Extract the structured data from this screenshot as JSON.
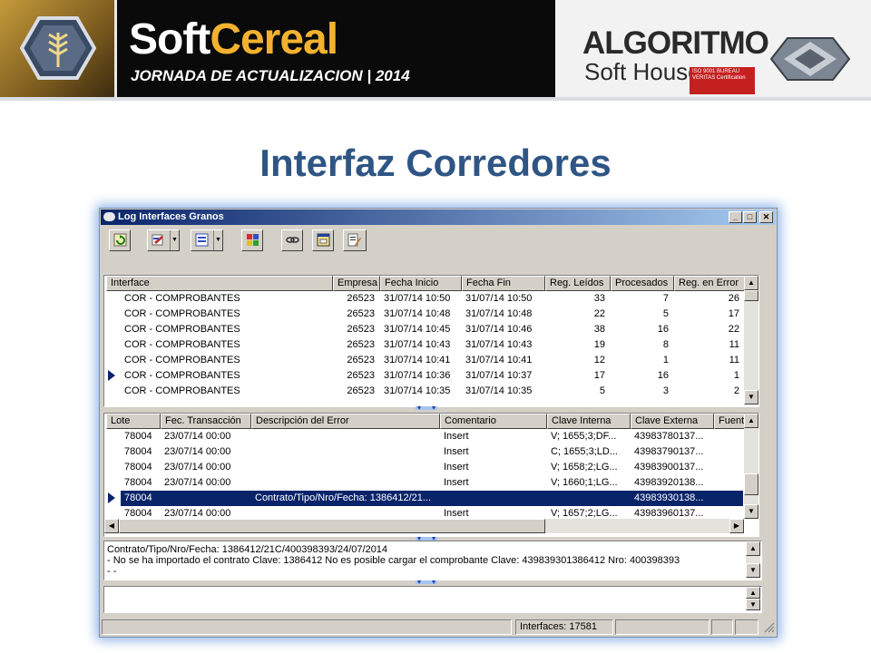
{
  "slide": {
    "banner": {
      "brand_part1": "Soft",
      "brand_part2": "Cereal",
      "brand_sub": "JORNADA DE ACTUALIZACION | 2014",
      "partner_title": "ALGORITMO",
      "partner_sub": "Soft House",
      "iso_text": "ISO 9001 BUREAU VERITAS Certification",
      "colors": {
        "brand_gold": "#f2b230",
        "banner_bg": "#0a0a0a",
        "iso_red": "#c42020"
      }
    },
    "title": "Interfaz Corredores",
    "title_color": "#2f5584"
  },
  "window": {
    "title": "Log Interfaces Granos",
    "controls": {
      "minimize": "_",
      "maximize": "□",
      "close": "✕"
    },
    "toolbar": [
      {
        "name": "refresh-icon",
        "dropdown": false
      },
      {
        "name": "edit-icon",
        "dropdown": true
      },
      {
        "name": "list-icon",
        "dropdown": true
      },
      {
        "name": "grid-color-icon",
        "dropdown": false
      },
      {
        "name": "link-icon",
        "dropdown": false
      },
      {
        "name": "window-icon",
        "dropdown": false
      },
      {
        "name": "report-edit-icon",
        "dropdown": false
      }
    ],
    "interfaces_grid": {
      "columns": [
        "Interface",
        "Empresa",
        "Fecha Inicio",
        "Fecha Fin",
        "Reg. Leídos",
        "Procesados",
        "Reg. en Error"
      ],
      "rows": [
        [
          "COR - COMPROBANTES",
          "26523",
          "31/07/14 10:50",
          "31/07/14 10:50",
          "33",
          "7",
          "26"
        ],
        [
          "COR - COMPROBANTES",
          "26523",
          "31/07/14 10:48",
          "31/07/14 10:48",
          "22",
          "5",
          "17"
        ],
        [
          "COR - COMPROBANTES",
          "26523",
          "31/07/14 10:45",
          "31/07/14 10:46",
          "38",
          "16",
          "22"
        ],
        [
          "COR - COMPROBANTES",
          "26523",
          "31/07/14 10:43",
          "31/07/14 10:43",
          "19",
          "8",
          "11"
        ],
        [
          "COR - COMPROBANTES",
          "26523",
          "31/07/14 10:41",
          "31/07/14 10:41",
          "12",
          "1",
          "11"
        ],
        [
          "COR - COMPROBANTES",
          "26523",
          "31/07/14 10:36",
          "31/07/14 10:37",
          "17",
          "16",
          "1"
        ],
        [
          "COR - COMPROBANTES",
          "26523",
          "31/07/14 10:35",
          "31/07/14 10:35",
          "5",
          "3",
          "2"
        ]
      ],
      "current_row": 5
    },
    "errors_grid": {
      "columns": [
        "Lote",
        "Fec. Transacción",
        "Descripción del Error",
        "Comentario",
        "Clave Interna",
        "Clave Externa",
        "Fuent"
      ],
      "rows": [
        [
          "78004",
          "23/07/14 00:00",
          "",
          "Insert",
          "V;  1655;3;DF...",
          "43983780137...",
          ""
        ],
        [
          "78004",
          "23/07/14 00:00",
          "",
          "Insert",
          "C;  1655;3;LD...",
          "43983790137...",
          ""
        ],
        [
          "78004",
          "23/07/14 00:00",
          "",
          "Insert",
          "V;  1658;2;LG...",
          "43983900137...",
          ""
        ],
        [
          "78004",
          "23/07/14 00:00",
          "",
          "Insert",
          "V;  1660;1;LG...",
          "43983920138...",
          ""
        ],
        [
          "78004",
          "",
          "Contrato/Tipo/Nro/Fecha: 1386412/21...",
          "",
          "",
          "43983930138...",
          ""
        ],
        [
          "78004",
          "23/07/14 00:00",
          "",
          "Insert",
          "V;  1657;2;LG...",
          "43983960137...",
          ""
        ]
      ],
      "selected_row": 4
    },
    "detail_memo": {
      "lines": [
        "Contrato/Tipo/Nro/Fecha: 1386412/21C/400398393/24/07/2014",
        " - No se ha importado el contrato Clave: 1386412 No es posible cargar el comprobante Clave: 439839301386412 Nro: 400398393",
        " - -"
      ]
    },
    "status": {
      "interfaces": "Interfaces:  17581"
    },
    "colors": {
      "selection": "#0a246a",
      "face": "#d4d0c8"
    }
  }
}
